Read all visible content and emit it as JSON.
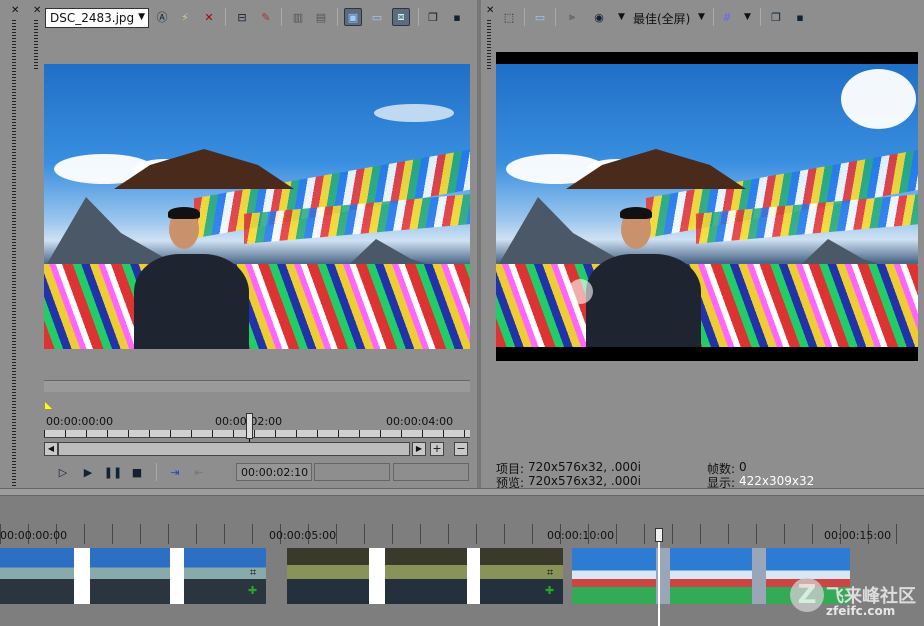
{
  "source_file": "DSC_2483.jpg",
  "left_toolbar_icons": [
    "text-icon",
    "lightning-icon",
    "delete-icon",
    "split-icon",
    "edit-icon",
    "film-strip-icon",
    "film-frame-icon",
    "preview-mode-icon",
    "monitor-icon",
    "dual-view-icon",
    "copy-icon",
    "save-icon"
  ],
  "right_toolbar_icons": [
    "cursor-icon",
    "monitor-icon",
    "split-view-icon",
    "overlay-icon",
    "grid-icon",
    "copy-icon",
    "save-icon"
  ],
  "preview_quality": "最佳(全屏)",
  "trimmer": {
    "time_start": "00:00:00:00",
    "time_mid": "00:00:02:00",
    "time_end": "00:00:04:00",
    "current_time": "00:00:02:10"
  },
  "preview_info": {
    "project_label": "项目:",
    "project_value": "720x576x32, .000i",
    "preview_label": "预览:",
    "preview_value": "720x576x32, .000i",
    "frames_label": "帧数:",
    "frames_value": "0",
    "display_label": "显示:",
    "display_value": "422x309x32"
  },
  "timeline": {
    "ticks": [
      "00:00:00:00",
      "00:00:05:00",
      "00:00:10:00",
      "00:00:15:00"
    ]
  },
  "watermark": {
    "title": "飞来峰社区",
    "subtitle": "zfeifc.com"
  }
}
